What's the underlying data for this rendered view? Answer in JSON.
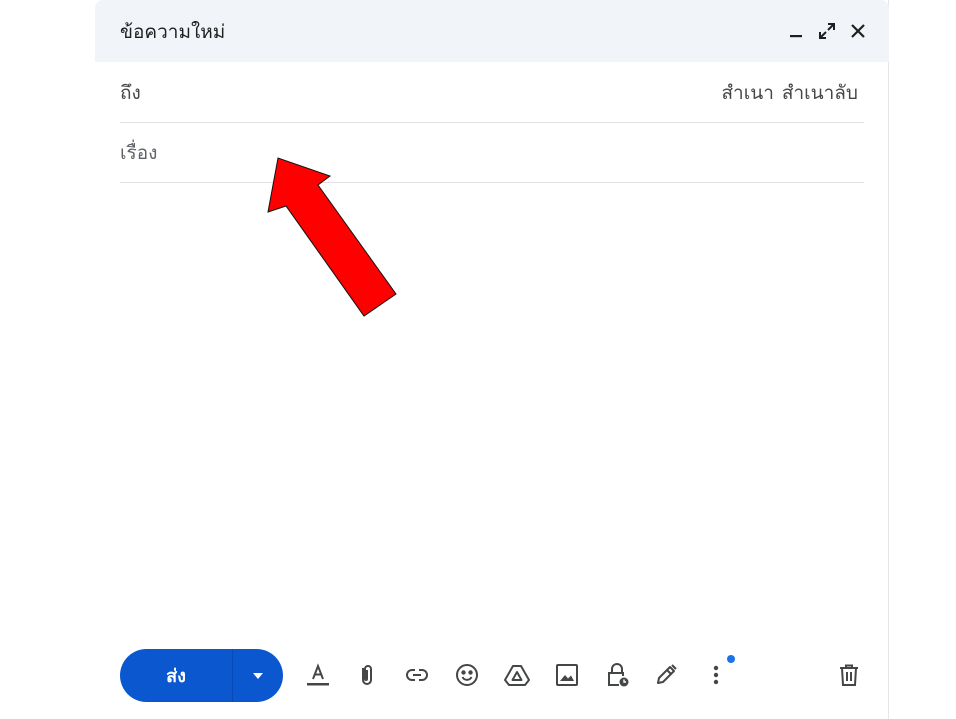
{
  "window": {
    "title": "ข้อความใหม่"
  },
  "fields": {
    "to_label": "ถึง",
    "cc_label": "สำเนา",
    "bcc_label": "สำเนาลับ",
    "subject_placeholder": "เรื่อง"
  },
  "toolbar": {
    "send_label": "ส่ง"
  },
  "colors": {
    "accent": "#0b57d0",
    "header_bg": "#f1f4f9",
    "annotation_arrow": "#ff0000"
  },
  "icons": {
    "header": [
      "minimize-icon",
      "expand-icon",
      "close-icon"
    ],
    "toolbar": [
      "format-text-icon",
      "attach-icon",
      "link-icon",
      "emoji-icon",
      "drive-icon",
      "image-icon",
      "confidential-icon",
      "signature-icon",
      "more-options-icon",
      "trash-icon"
    ]
  }
}
